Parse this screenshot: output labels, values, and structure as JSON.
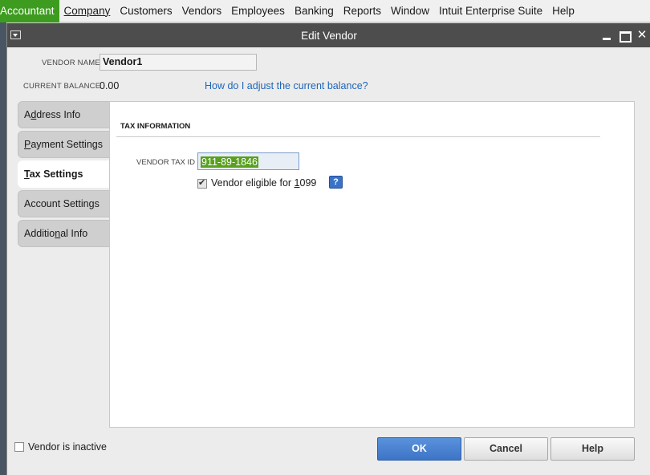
{
  "menubar": {
    "items": [
      "Accountant",
      "Company",
      "Customers",
      "Vendors",
      "Employees",
      "Banking",
      "Reports",
      "Window",
      "Intuit Enterprise Suite",
      "Help"
    ],
    "active_item": "Accountant",
    "active_color": "#3d9c1f"
  },
  "window": {
    "title": "Edit Vendor",
    "close_glyph": "✕"
  },
  "header": {
    "vendor_name_label": "VENDOR NAME",
    "vendor_name_value": "Vendor1",
    "current_balance_label": "CURRENT BALANCE",
    "current_balance_value": "0.00",
    "balance_help_link": "How do I adjust the current balance?"
  },
  "tabs": [
    {
      "pre": "A",
      "u": "d",
      "post": "dress Info",
      "selected": false
    },
    {
      "pre": "",
      "u": "P",
      "post": "ayment Settings",
      "selected": false
    },
    {
      "pre": "",
      "u": "T",
      "post": "ax Settings",
      "selected": true
    },
    {
      "pre": "Account Settin",
      "u": "g",
      "post": "s",
      "selected": false
    },
    {
      "pre": "Additio",
      "u": "n",
      "post": "al Info",
      "selected": false
    }
  ],
  "tax_info": {
    "section_title": "TAX INFORMATION",
    "tax_id_label": "VENDOR TAX ID",
    "tax_id_value": "911-89-1846",
    "eligible_1099": {
      "pre": "Vendor eligible for ",
      "u": "1",
      "post": "099",
      "checked": true
    },
    "help_glyph": "?"
  },
  "footer": {
    "inactive_label": "Vendor is inactive",
    "inactive_checked": false,
    "ok_label": "OK",
    "cancel_label": "Cancel",
    "help_label": "Help"
  }
}
